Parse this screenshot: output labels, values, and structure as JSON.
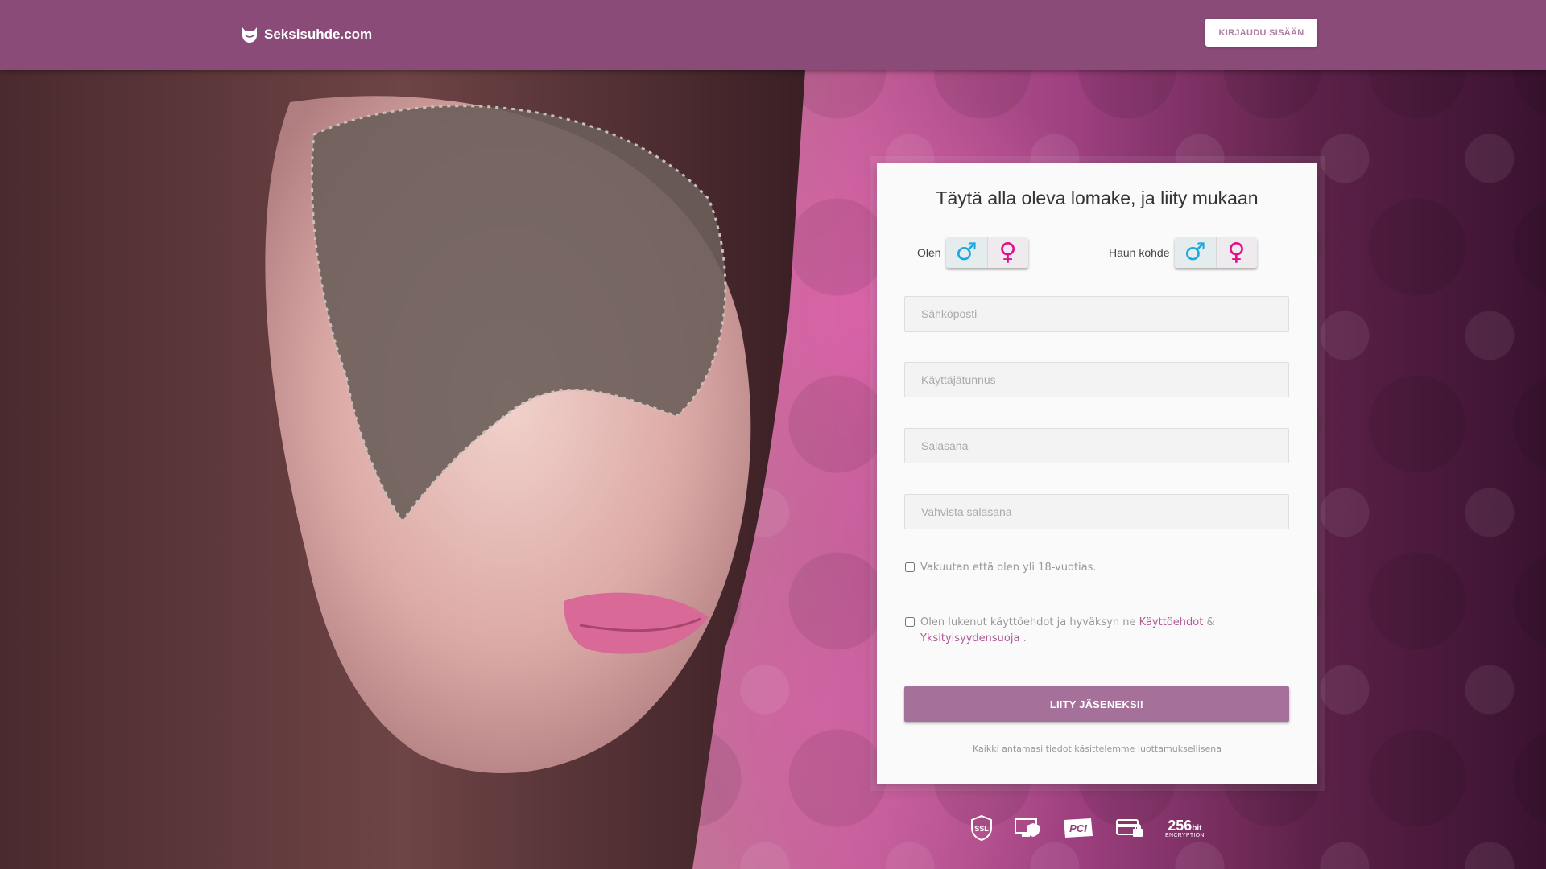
{
  "header": {
    "logo_text": "Seksisuhde.com",
    "login_label": "KIRJAUDU SISÄÄN"
  },
  "form": {
    "title": "Täytä alla oleva lomake, ja liity mukaan",
    "i_am_label": "Olen",
    "seeking_label": "Haun kohde",
    "male_symbol": "♂",
    "female_symbol": "♀",
    "email_placeholder": "Sähköposti",
    "username_placeholder": "Käyttäjätunnus",
    "password_placeholder": "Salasana",
    "confirm_password_placeholder": "Vahvista salasana",
    "age_check_text": "Vakuutan että olen yli 18-vuotias.",
    "terms_text_prefix": "Olen lukenut käyttöehdot ja hyväksyn ne",
    "terms_link": "Käyttöehdot",
    "terms_amp": "&",
    "privacy_link": "Yksityisyydensuoja",
    "terms_suffix": ".",
    "join_label": "LIITY JÄSENEKSI!",
    "privacy_note": "Kaikki antamasi tiedot käsittelemme luottamuksellisena"
  },
  "badges": {
    "ssl": "SSL",
    "pci": "PCI",
    "encryption_num": "256",
    "encryption_unit": "bit",
    "encryption_sub": "ENCRYPTION"
  },
  "colors": {
    "header_bg": "#8a4b79",
    "accent": "#a5719a",
    "link": "#b15a95",
    "male": "#1aa8dd",
    "female": "#e0108a"
  }
}
